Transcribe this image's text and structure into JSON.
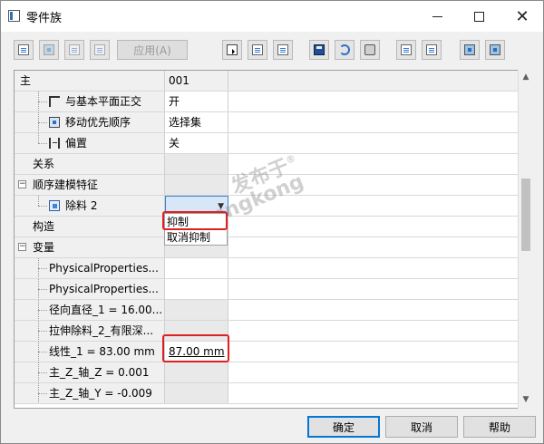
{
  "window": {
    "title": "零件族",
    "minimize_glyph": "",
    "maximize_glyph": "",
    "close_glyph": "✕"
  },
  "toolbar": {
    "apply_label": "应用(A)",
    "icons": [
      "family-table-icon",
      "preview-icon",
      "lock-icon",
      "edit-icon",
      "select-cursor-icon",
      "insert-column-icon",
      "delete-column-icon",
      "save-icon",
      "undo-icon",
      "print-icon",
      "copy-icon",
      "paste-icon",
      "model-icon",
      "model-view-icon"
    ]
  },
  "grid": {
    "header": {
      "name": "主",
      "value": "001"
    },
    "rows": [
      {
        "label": "与基本平面正交",
        "value": "开",
        "icon": "orthogonal-icon"
      },
      {
        "label": "移动优先顺序",
        "value": "选择集",
        "icon": "move-priority-icon"
      },
      {
        "label": "偏置",
        "value": "关",
        "icon": "offset-icon"
      },
      {
        "label": "关系",
        "value": ""
      },
      {
        "label": "顺序建模特征",
        "value": "",
        "expander": "−"
      },
      {
        "label": "除料 2",
        "value": "",
        "icon": "cut-feature-icon"
      },
      {
        "label": "构造",
        "value": ""
      },
      {
        "label": "变量",
        "value": "",
        "expander": "−"
      },
      {
        "label": "PhysicalProperties...",
        "value": ""
      },
      {
        "label": "PhysicalProperties...",
        "value": ""
      },
      {
        "label": "径向直径_1 = 16.00...",
        "value": ""
      },
      {
        "label": "拉伸除料_2_有限深...",
        "value": ""
      },
      {
        "label": "线性_1 = 83.00 mm",
        "value": "87.00 mm"
      },
      {
        "label": "主_Z_轴_Z = 0.001",
        "value": ""
      },
      {
        "label": "主_Z_轴_Y = -0.009",
        "value": ""
      }
    ],
    "dropdown_options": [
      "抑制",
      "取消抑制"
    ]
  },
  "watermark": {
    "line1": "发布于",
    "line2": "gongkong",
    "mark": "®"
  },
  "buttons": {
    "ok": "确定",
    "cancel": "取消",
    "help": "帮助"
  },
  "colors": {
    "highlight_red": "#e02020",
    "selection_blue": "#3c7fd1",
    "default_button_border": "#0078d7"
  }
}
